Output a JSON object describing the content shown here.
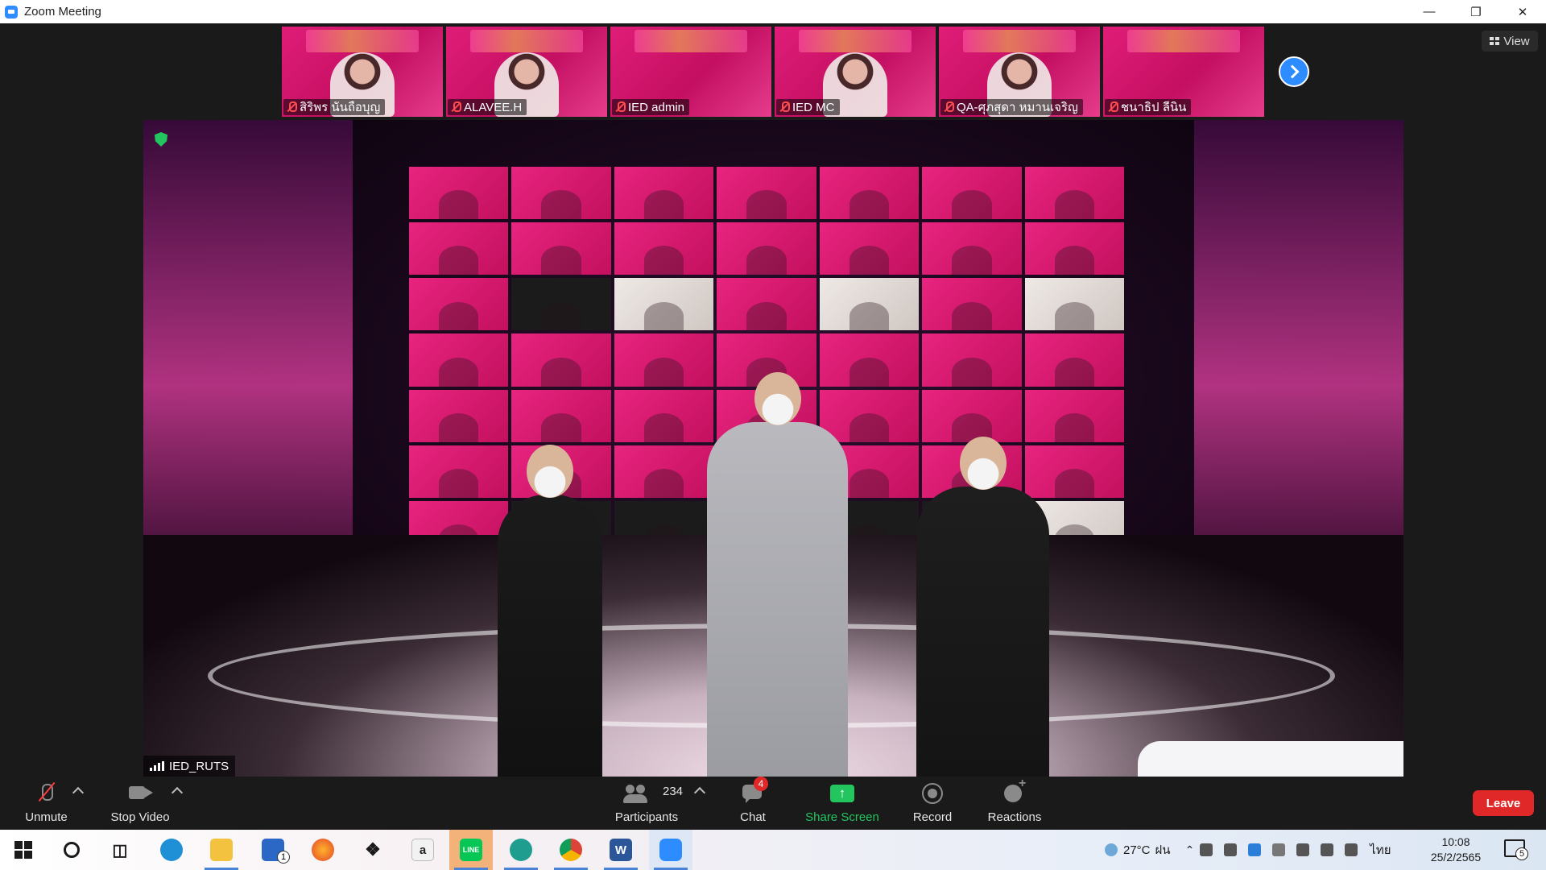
{
  "window": {
    "title": "Zoom Meeting",
    "controls": [
      "minimize",
      "restore",
      "close"
    ]
  },
  "thumbnails": [
    {
      "name": "สิริพร นันถือบุญ",
      "muted": true
    },
    {
      "name": "ALAVEE.H",
      "muted": true
    },
    {
      "name": "IED admin",
      "muted": true
    },
    {
      "name": "IED MC",
      "muted": true
    },
    {
      "name": "QA-ศุภสุดา หมานเจริญ",
      "muted": true
    },
    {
      "name": "ชนาธิป ลีนิน",
      "muted": true
    }
  ],
  "view_button": {
    "label": "View"
  },
  "main_video": {
    "speaker_name": "IED_RUTS"
  },
  "toolbar": {
    "unmute_label": "Unmute",
    "stop_video_label": "Stop Video",
    "participants_label": "Participants",
    "participants_count": "234",
    "chat_label": "Chat",
    "chat_badge": "4",
    "share_screen_label": "Share Screen",
    "record_label": "Record",
    "reactions_label": "Reactions",
    "leave_label": "Leave"
  },
  "taskbar": {
    "apps": [
      "start",
      "search",
      "task-view",
      "edge",
      "file-explorer",
      "mail",
      "firefox",
      "dropbox",
      "amazon",
      "line",
      "edge-dev",
      "chrome",
      "word",
      "zoom"
    ],
    "mail_badge": "1",
    "line_label": "LINE",
    "word_label": "W",
    "weather_temp": "27°C",
    "weather_desc": "ฝน",
    "language": "ไทย",
    "time": "10:08",
    "date": "25/2/2565",
    "notification_count": "5"
  },
  "colors": {
    "zoom_blue": "#2d8cff",
    "leave_red": "#e02828",
    "share_green": "#23c55e",
    "thumb_pink": "#e01d78",
    "muted_red": "#ff4d4d"
  }
}
